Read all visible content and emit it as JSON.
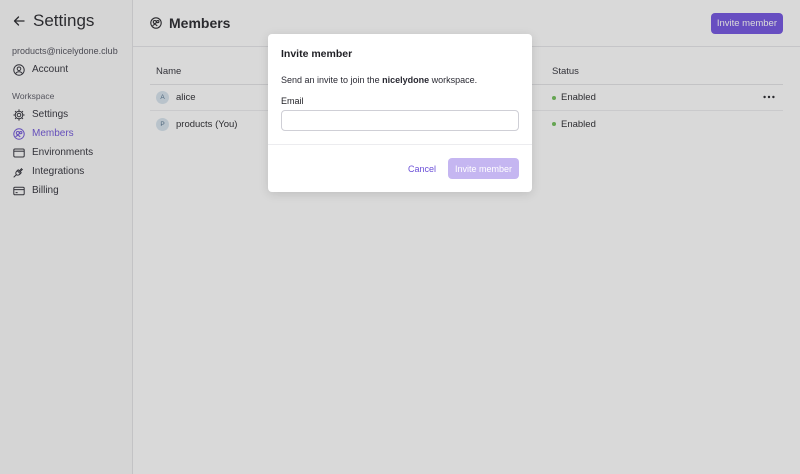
{
  "sidebar": {
    "title": "Settings",
    "email": "products@nicelydone.club",
    "account_label": "Account",
    "section_label": "Workspace",
    "items": [
      {
        "label": "Settings",
        "icon": "gear-icon"
      },
      {
        "label": "Members",
        "icon": "members-icon"
      },
      {
        "label": "Environments",
        "icon": "window-icon"
      },
      {
        "label": "Integrations",
        "icon": "plug-icon"
      },
      {
        "label": "Billing",
        "icon": "card-icon"
      }
    ],
    "active_item": "Members"
  },
  "header": {
    "title": "Members",
    "invite_button": "Invite member"
  },
  "table": {
    "columns": [
      "Name",
      "Status"
    ],
    "rows": [
      {
        "initial": "A",
        "name": "alice",
        "status": "Enabled"
      },
      {
        "initial": "P",
        "name": "products (You)",
        "status": "Enabled"
      }
    ]
  },
  "modal": {
    "title": "Invite member",
    "desc_prefix": "Send an invite to join the ",
    "workspace": "nicelydone",
    "desc_suffix": " workspace.",
    "email_label": "Email",
    "email_value": "",
    "cancel_label": "Cancel",
    "submit_label": "Invite member"
  },
  "colors": {
    "accent": "#6e4ee0",
    "accent_disabled": "#c5b6f1",
    "status_enabled": "#6bbd52"
  }
}
